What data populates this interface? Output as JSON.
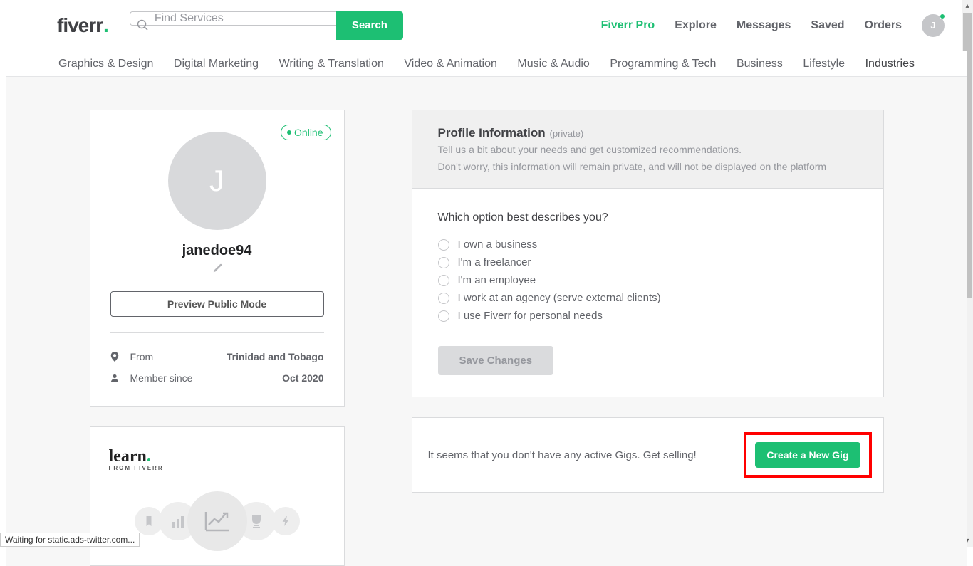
{
  "header": {
    "logo_text": "fiverr",
    "search_placeholder": "Find Services",
    "search_button": "Search",
    "nav": {
      "pro": "Fiverr Pro",
      "explore": "Explore",
      "messages": "Messages",
      "saved": "Saved",
      "orders": "Orders"
    },
    "avatar_initial": "J"
  },
  "categories": [
    "Graphics & Design",
    "Digital Marketing",
    "Writing & Translation",
    "Video & Animation",
    "Music & Audio",
    "Programming & Tech",
    "Business",
    "Lifestyle",
    "Industries"
  ],
  "profile": {
    "online_badge": "Online",
    "avatar_initial": "J",
    "username": "janedoe94",
    "preview_button": "Preview Public Mode",
    "from_label": "From",
    "from_value": "Trinidad and Tobago",
    "member_label": "Member since",
    "member_value": "Oct 2020"
  },
  "learn": {
    "logo": "learn",
    "sub": "FROM FIVERR"
  },
  "profile_info": {
    "title": "Profile Information",
    "private": "(private)",
    "line1": "Tell us a bit about your needs and get customized recommendations.",
    "line2": "Don't worry, this information will remain private, and will not be displayed on the platform",
    "question": "Which option best describes you?",
    "options": [
      "I own a business",
      "I'm a freelancer",
      "I'm an employee",
      "I work at an agency (serve external clients)",
      "I use Fiverr for personal needs"
    ],
    "save_button": "Save Changes"
  },
  "gigs": {
    "empty_text": "It seems that you don't have any active Gigs. Get selling!",
    "create_button": "Create a New Gig"
  },
  "status_bar": "Waiting for static.ads-twitter.com..."
}
